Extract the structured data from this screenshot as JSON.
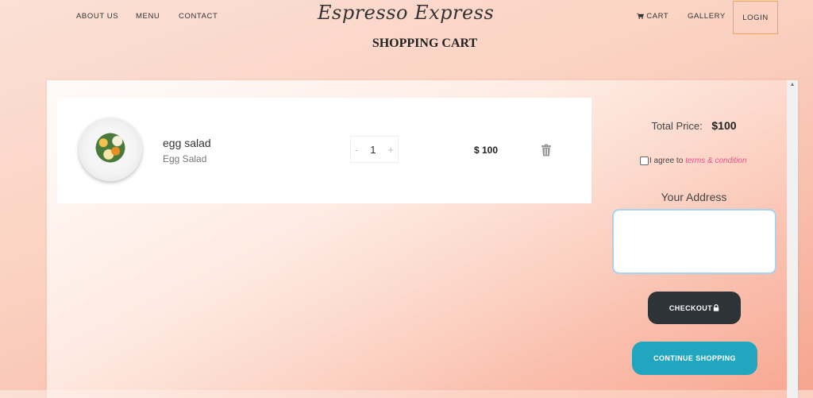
{
  "nav": {
    "about": "ABOUT US",
    "menu": "MENU",
    "contact": "CONTACT",
    "brand": "Espresso Express",
    "cart": "CART",
    "gallery": "GALLERY",
    "login": "LOGIN"
  },
  "page": {
    "title": "SHOPPING CART"
  },
  "cart": {
    "items": [
      {
        "name": "egg salad",
        "subtitle": "Egg Salad",
        "quantity": "1",
        "price": "$ 100",
        "qty_minus": "-",
        "qty_plus": "+"
      }
    ]
  },
  "summary": {
    "total_label": "Total Price:",
    "total_value": "$100",
    "agree_text": "I agree to",
    "terms_link": "terms & condition",
    "address_label": "Your Address",
    "checkout_label": "CHECKOUT",
    "continue_label": "CONTINUE SHOPPING"
  },
  "colors": {
    "checkout_bg": "#2d3336",
    "continue_bg": "#22a6c0",
    "login_border": "#f0a64c",
    "terms_link": "#e8508a"
  },
  "icons": [
    "cart-icon",
    "trash-icon",
    "lock-icon",
    "food-image"
  ]
}
